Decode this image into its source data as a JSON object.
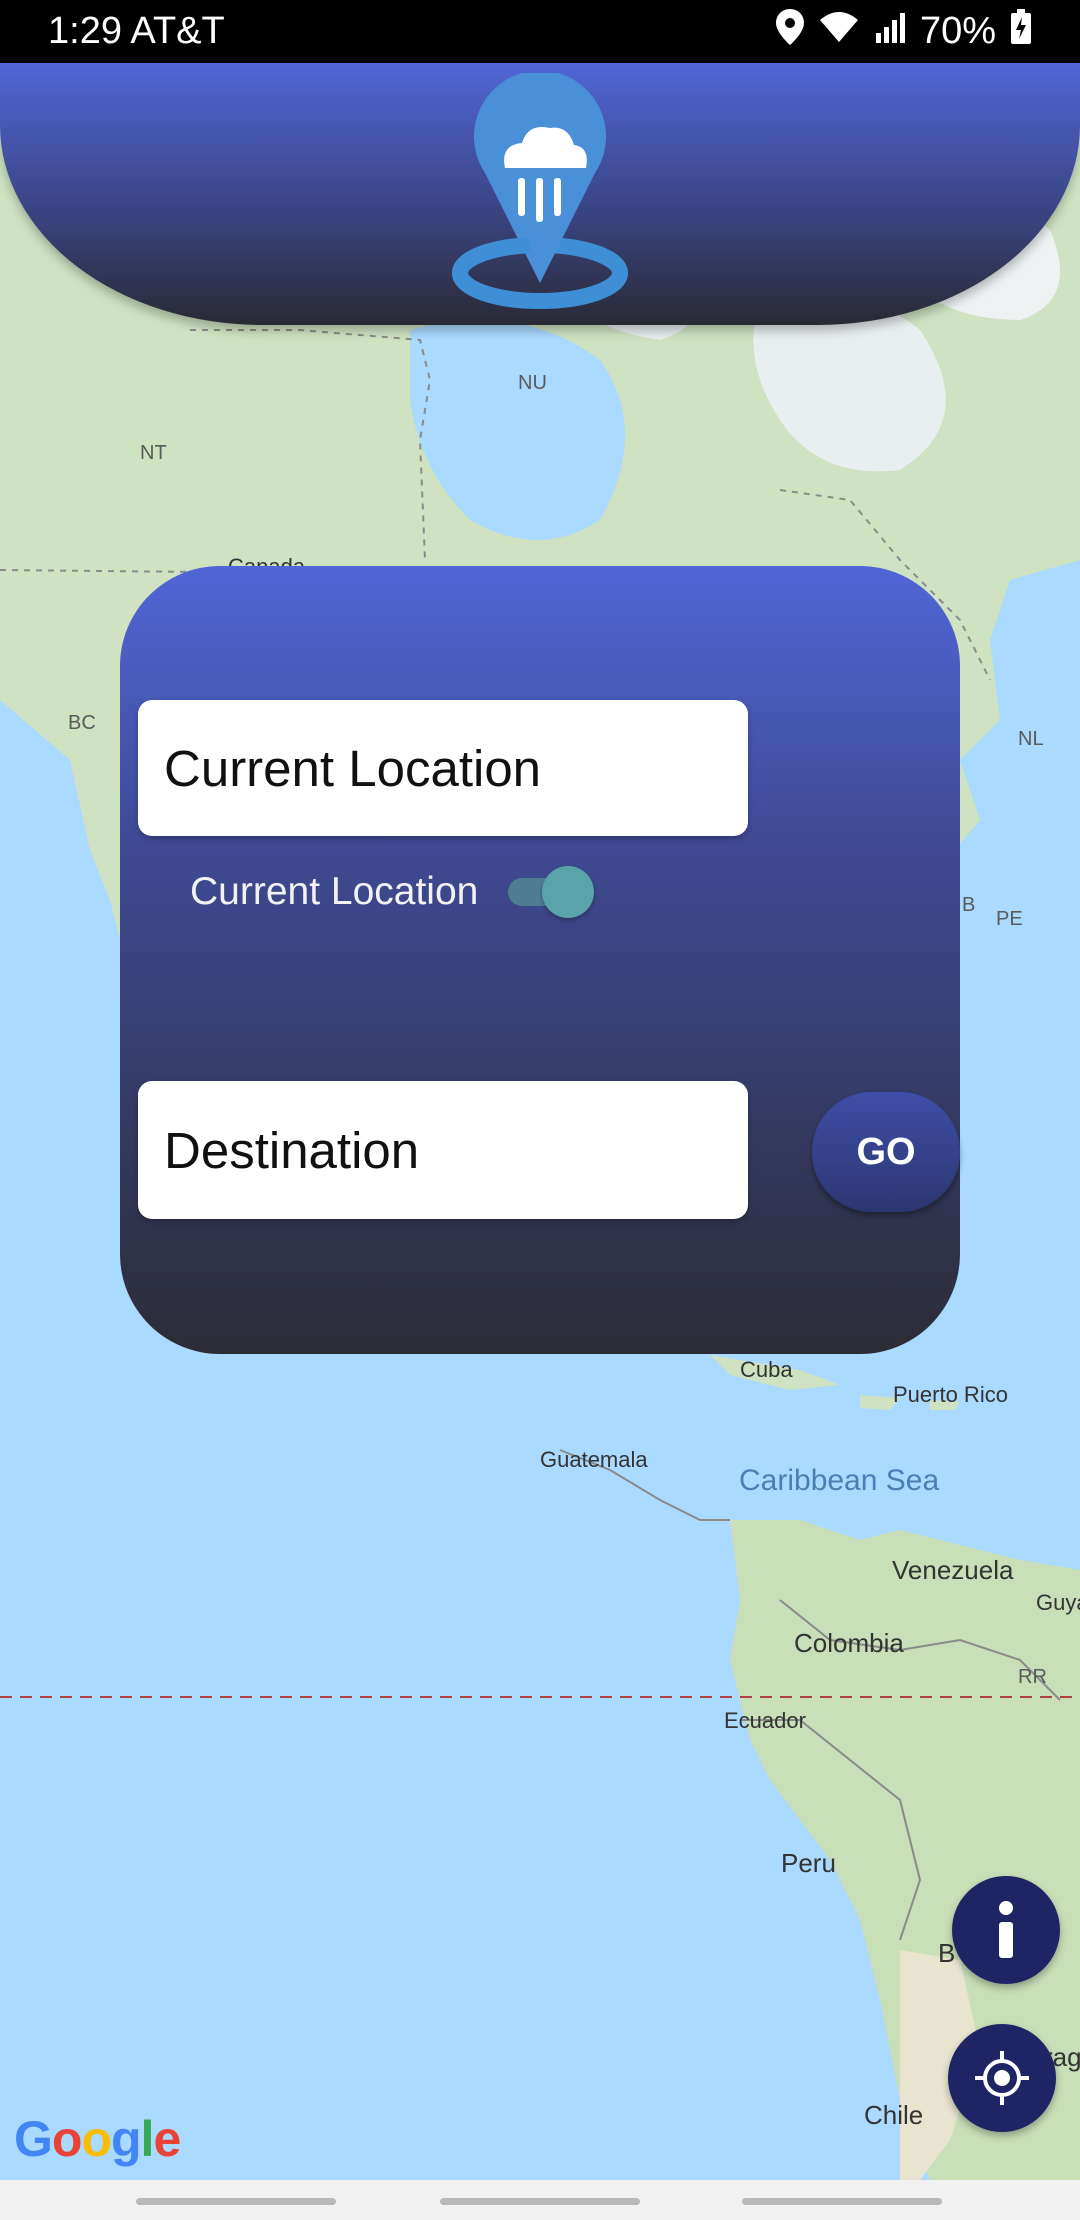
{
  "status_bar": {
    "time_carrier": "1:29 AT&T",
    "battery": "70%"
  },
  "map": {
    "labels": {
      "nu": "NU",
      "nt": "NT",
      "canada": "Canada",
      "bc": "BC",
      "nl": "NL",
      "b": "B",
      "pe": "PE",
      "cuba": "Cuba",
      "puerto_rico": "Puerto Rico",
      "guatemala": "Guatemala",
      "caribbean_sea": "Caribbean Sea",
      "venezuela": "Venezuela",
      "guya": "Guya",
      "colombia": "Colombia",
      "rr": "RR",
      "ecuador": "Ecuador",
      "peru": "Peru",
      "bo": "B",
      "rag": "rag",
      "chile": "Chile"
    },
    "attribution": {
      "g": "G",
      "o1": "o",
      "o2": "o",
      "g2": "g",
      "l": "l",
      "e": "e"
    }
  },
  "panel": {
    "origin_value": "Current Location",
    "toggle_label": "Current Location",
    "toggle_on": true,
    "destination_placeholder": "Destination",
    "go_label": "GO"
  },
  "colors": {
    "header_top": "#5066d6",
    "header_bottom": "#2a2a35",
    "fab": "#1f2465",
    "toggle_thumb": "#5aa3a8"
  },
  "icons": {
    "logo": "rain-location-pin-icon",
    "info": "info-icon",
    "locate": "my-location-icon"
  }
}
